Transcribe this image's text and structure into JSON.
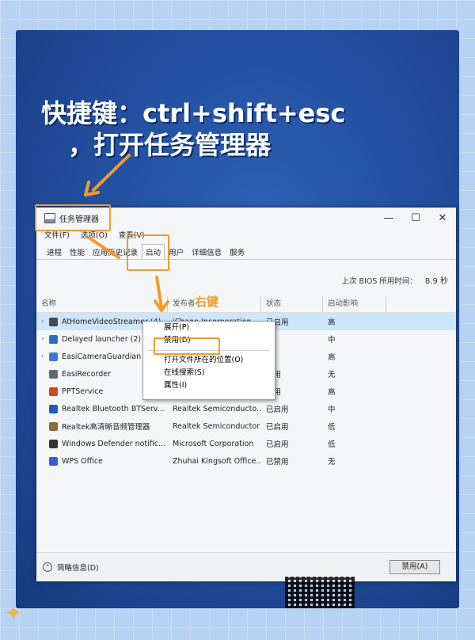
{
  "caption": {
    "line1": "快捷键：ctrl+shift+esc",
    "line2": "，打开任务管理器"
  },
  "window": {
    "title": "任务管理器",
    "controls": [
      "—",
      "☐",
      "✕"
    ],
    "menu": [
      "文件(F)",
      "选项(O)",
      "查看(V)"
    ],
    "tabs": [
      "进程",
      "性能",
      "应用历史记录",
      "启动",
      "用户",
      "详细信息",
      "服务"
    ],
    "active_tab": "启动",
    "bios_label": "上次 BIOS 所用时间：",
    "bios_value": "8.9 秒",
    "columns": [
      "名称",
      "发布者",
      "状态",
      "启动影响"
    ],
    "rows": [
      {
        "name": "AtHomeVideoStreamer (4)",
        "publisher": "iChano Incorporation",
        "status": "已启用",
        "impact": "高",
        "expand": "›",
        "icon_color": "#4a4a4a"
      },
      {
        "name": "Delayed launcher (2)",
        "publisher": "",
        "status": "",
        "impact": "中",
        "expand": "›",
        "icon_color": "#2b6cc4"
      },
      {
        "name": "EasiCameraGuardian",
        "publisher": "",
        "status": "",
        "impact": "高",
        "expand": "›",
        "icon_color": "#3a7ad8"
      },
      {
        "name": "EasiRecorder",
        "publisher": "",
        "status": "禁用",
        "impact": "无",
        "expand": "",
        "icon_color": "#5b6b7b"
      },
      {
        "name": "PPTService",
        "publisher": "",
        "status": "启用",
        "impact": "高",
        "expand": "",
        "icon_color": "#d24726"
      },
      {
        "name": "Realtek Bluetooth BTServ...",
        "publisher": "Realtek Semiconducto...",
        "status": "已启用",
        "impact": "中",
        "expand": "",
        "icon_color": "#1e5bb8"
      },
      {
        "name": "Realtek高清晰音频管理器",
        "publisher": "Realtek Semiconductor",
        "status": "已启用",
        "impact": "低",
        "expand": "",
        "icon_color": "#8a6d3b"
      },
      {
        "name": "Windows Defender notific...",
        "publisher": "Microsoft Corporation",
        "status": "已启用",
        "impact": "低",
        "expand": "",
        "icon_color": "#333333"
      },
      {
        "name": "WPS Office",
        "publisher": "Zhuhai Kingsoft Office...",
        "status": "已禁用",
        "impact": "无",
        "expand": "",
        "icon_color": "#3b5bd6"
      }
    ],
    "context_menu": [
      "展开(P)",
      "禁用(D)",
      "打开文件所在的位置(O)",
      "在线搜索(S)",
      "属性(I)"
    ],
    "fewer_details": "简略信息(D)",
    "disable_button": "禁用(A)"
  },
  "annotation": {
    "right_click_label": "右键",
    "accent": "#f39a2b"
  }
}
